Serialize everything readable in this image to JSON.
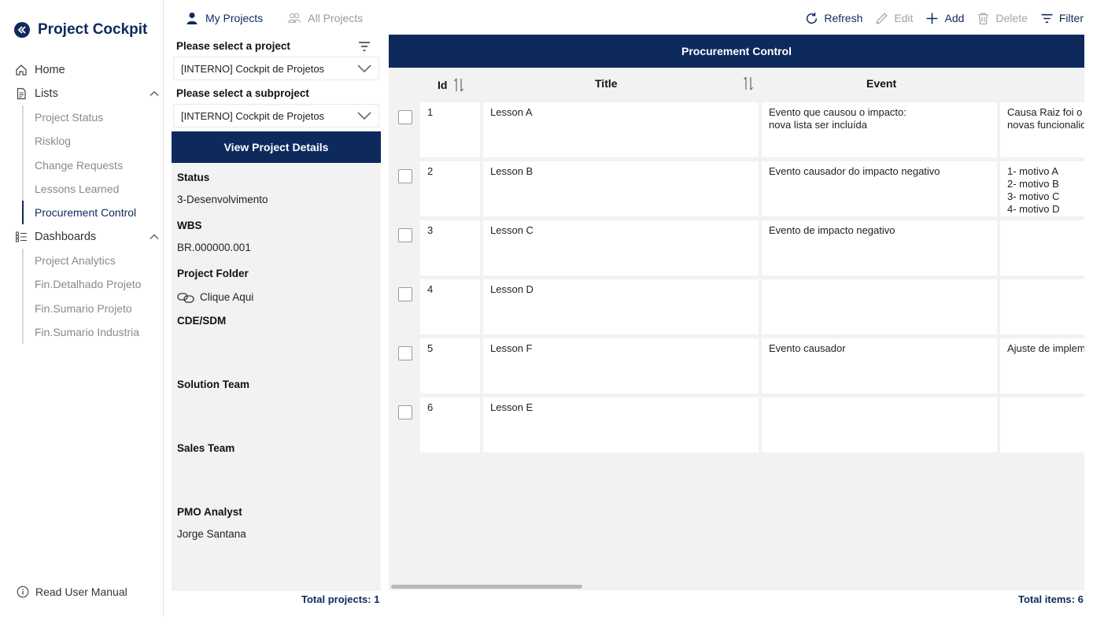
{
  "app": {
    "title": "Project Cockpit"
  },
  "sidebar": {
    "home": "Home",
    "lists": {
      "label": "Lists",
      "items": [
        "Project Status",
        "Risklog",
        "Change Requests",
        "Lessons Learned",
        "Procurement Control"
      ],
      "active": "Procurement Control"
    },
    "dashboards": {
      "label": "Dashboards",
      "items": [
        "Project Analytics",
        "Fin.Detalhado Projeto",
        "Fin.Sumario Projeto",
        "Fin.Sumario Industria"
      ]
    },
    "manual": "Read User Manual"
  },
  "tabs": {
    "my_projects": "My Projects",
    "all_projects": "All Projects"
  },
  "toolbar": {
    "refresh": "Refresh",
    "edit": "Edit",
    "add": "Add",
    "delete": "Delete",
    "filter": "Filter"
  },
  "selector": {
    "project_label": "Please select a project",
    "project_value": "[INTERNO] Cockpit de Projetos",
    "subproject_label": "Please select a subproject",
    "subproject_value": "[INTERNO] Cockpit de Projetos",
    "details_button": "View Project Details"
  },
  "details": {
    "status_label": "Status",
    "status_value": "3-Desenvolvimento",
    "wbs_label": "WBS",
    "wbs_value": "BR.000000.001",
    "folder_label": "Project Folder",
    "folder_link": "Clique Aqui",
    "cde_label": "CDE/SDM",
    "solution_label": "Solution Team",
    "sales_label": "Sales Team",
    "pmo_label": "PMO Analyst",
    "pmo_value": "Jorge Santana",
    "total_projects": "Total projects: 1"
  },
  "grid": {
    "title": "Procurement Control",
    "columns": {
      "id": "Id",
      "title": "Title",
      "event": "Event"
    },
    "rows": [
      {
        "id": "1",
        "title": "Lesson A",
        "event": [
          "Evento que causou o impacto:",
          "nova lista ser incluída"
        ],
        "root": [
          "Causa Raiz foi o p",
          "novas funcionalid"
        ]
      },
      {
        "id": "2",
        "title": "Lesson B",
        "event": [
          "Evento causador do impacto negativo"
        ],
        "root": [
          "1- motivo A",
          "2- motivo B",
          "3- motivo C",
          "4- motivo D"
        ]
      },
      {
        "id": "3",
        "title": "Lesson C",
        "event": [
          "Evento de impacto negativo"
        ],
        "root": []
      },
      {
        "id": "4",
        "title": "Lesson D",
        "event": [],
        "root": []
      },
      {
        "id": "5",
        "title": "Lesson F",
        "event": [
          "Evento causador"
        ],
        "root": [
          "Ajuste de implem"
        ]
      },
      {
        "id": "6",
        "title": "Lesson E",
        "event": [],
        "root": []
      }
    ],
    "total_items": "Total items: 6"
  },
  "colors": {
    "brand": "#0e2a5c",
    "panel_bg": "#f2f2f2",
    "muted_text": "#8a8a8a"
  }
}
